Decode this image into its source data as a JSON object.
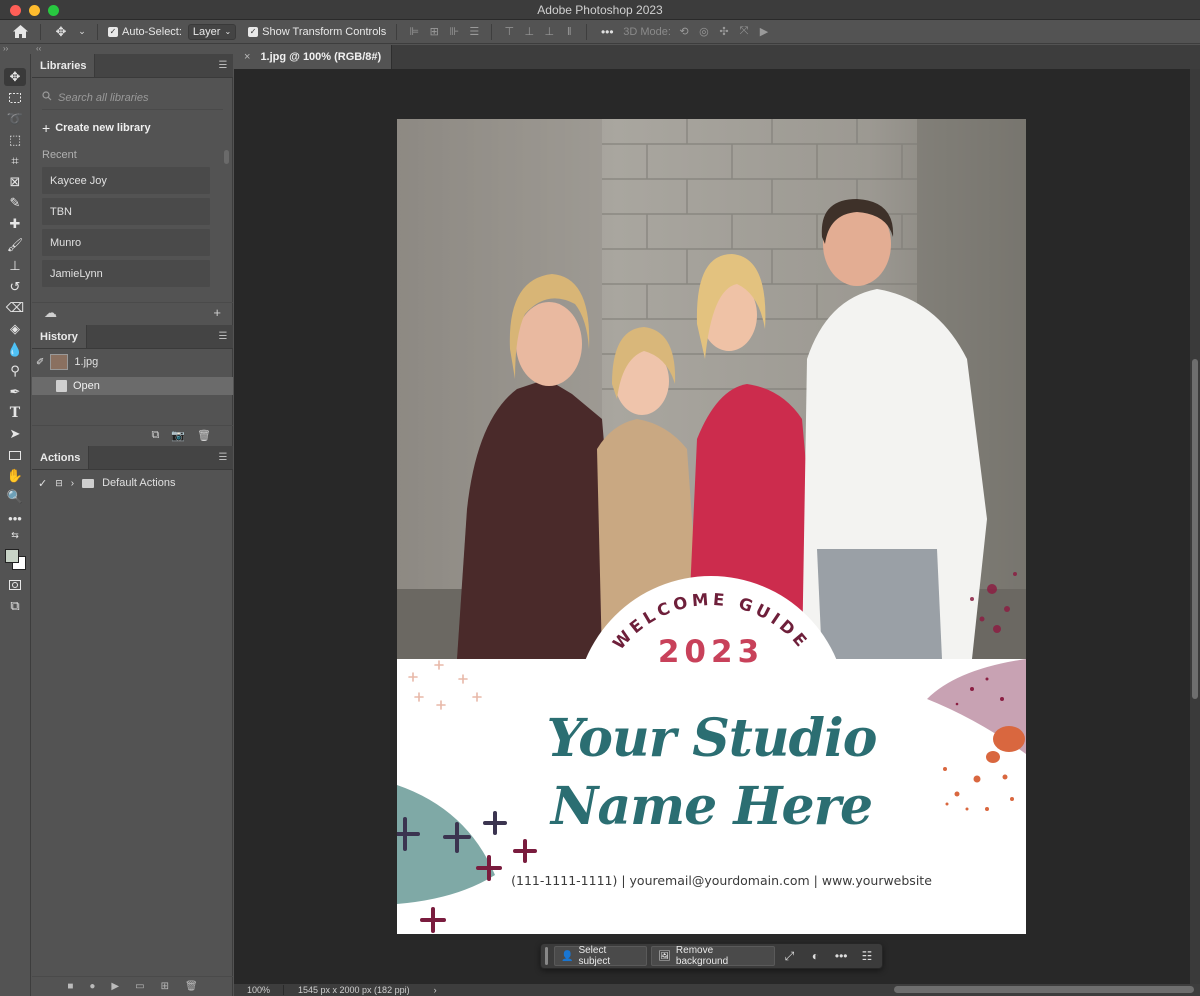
{
  "window": {
    "title": "Adobe Photoshop 2023"
  },
  "options_bar": {
    "auto_select_label": "Auto-Select:",
    "auto_select_value": "Layer",
    "transform_label": "Show Transform Controls",
    "mode_3d_label": "3D Mode:"
  },
  "libraries": {
    "tab": "Libraries",
    "search_placeholder": "Search all libraries",
    "create_label": "Create new library",
    "recent_label": "Recent",
    "items": [
      {
        "label": "Kaycee Joy"
      },
      {
        "label": "TBN"
      },
      {
        "label": "Munro"
      },
      {
        "label": "JamieLynn"
      }
    ]
  },
  "history": {
    "tab": "History",
    "snapshot": "1.jpg",
    "states": [
      {
        "label": "Open"
      }
    ]
  },
  "actions": {
    "tab": "Actions",
    "sets": [
      {
        "label": "Default Actions"
      }
    ]
  },
  "document": {
    "tab_label": "1.jpg @ 100% (RGB/8#)",
    "artwork": {
      "welcome": "WELCOME GUIDE",
      "year": "2023",
      "studio_line1": "Your Studio",
      "studio_line2": "Name Here",
      "contact": "(111-1111-1111)  |  youremail@yourdomain.com  | www.yourwebsite"
    }
  },
  "task_bar": {
    "select_subject": "Select subject",
    "remove_background": "Remove background"
  },
  "status": {
    "zoom": "100%",
    "doc_info": "1545 px x 2000 px (182 ppi)"
  },
  "colors": {
    "accent_teal": "#2b6e72",
    "accent_rose": "#c8415a",
    "plum": "#6e1f3a"
  }
}
